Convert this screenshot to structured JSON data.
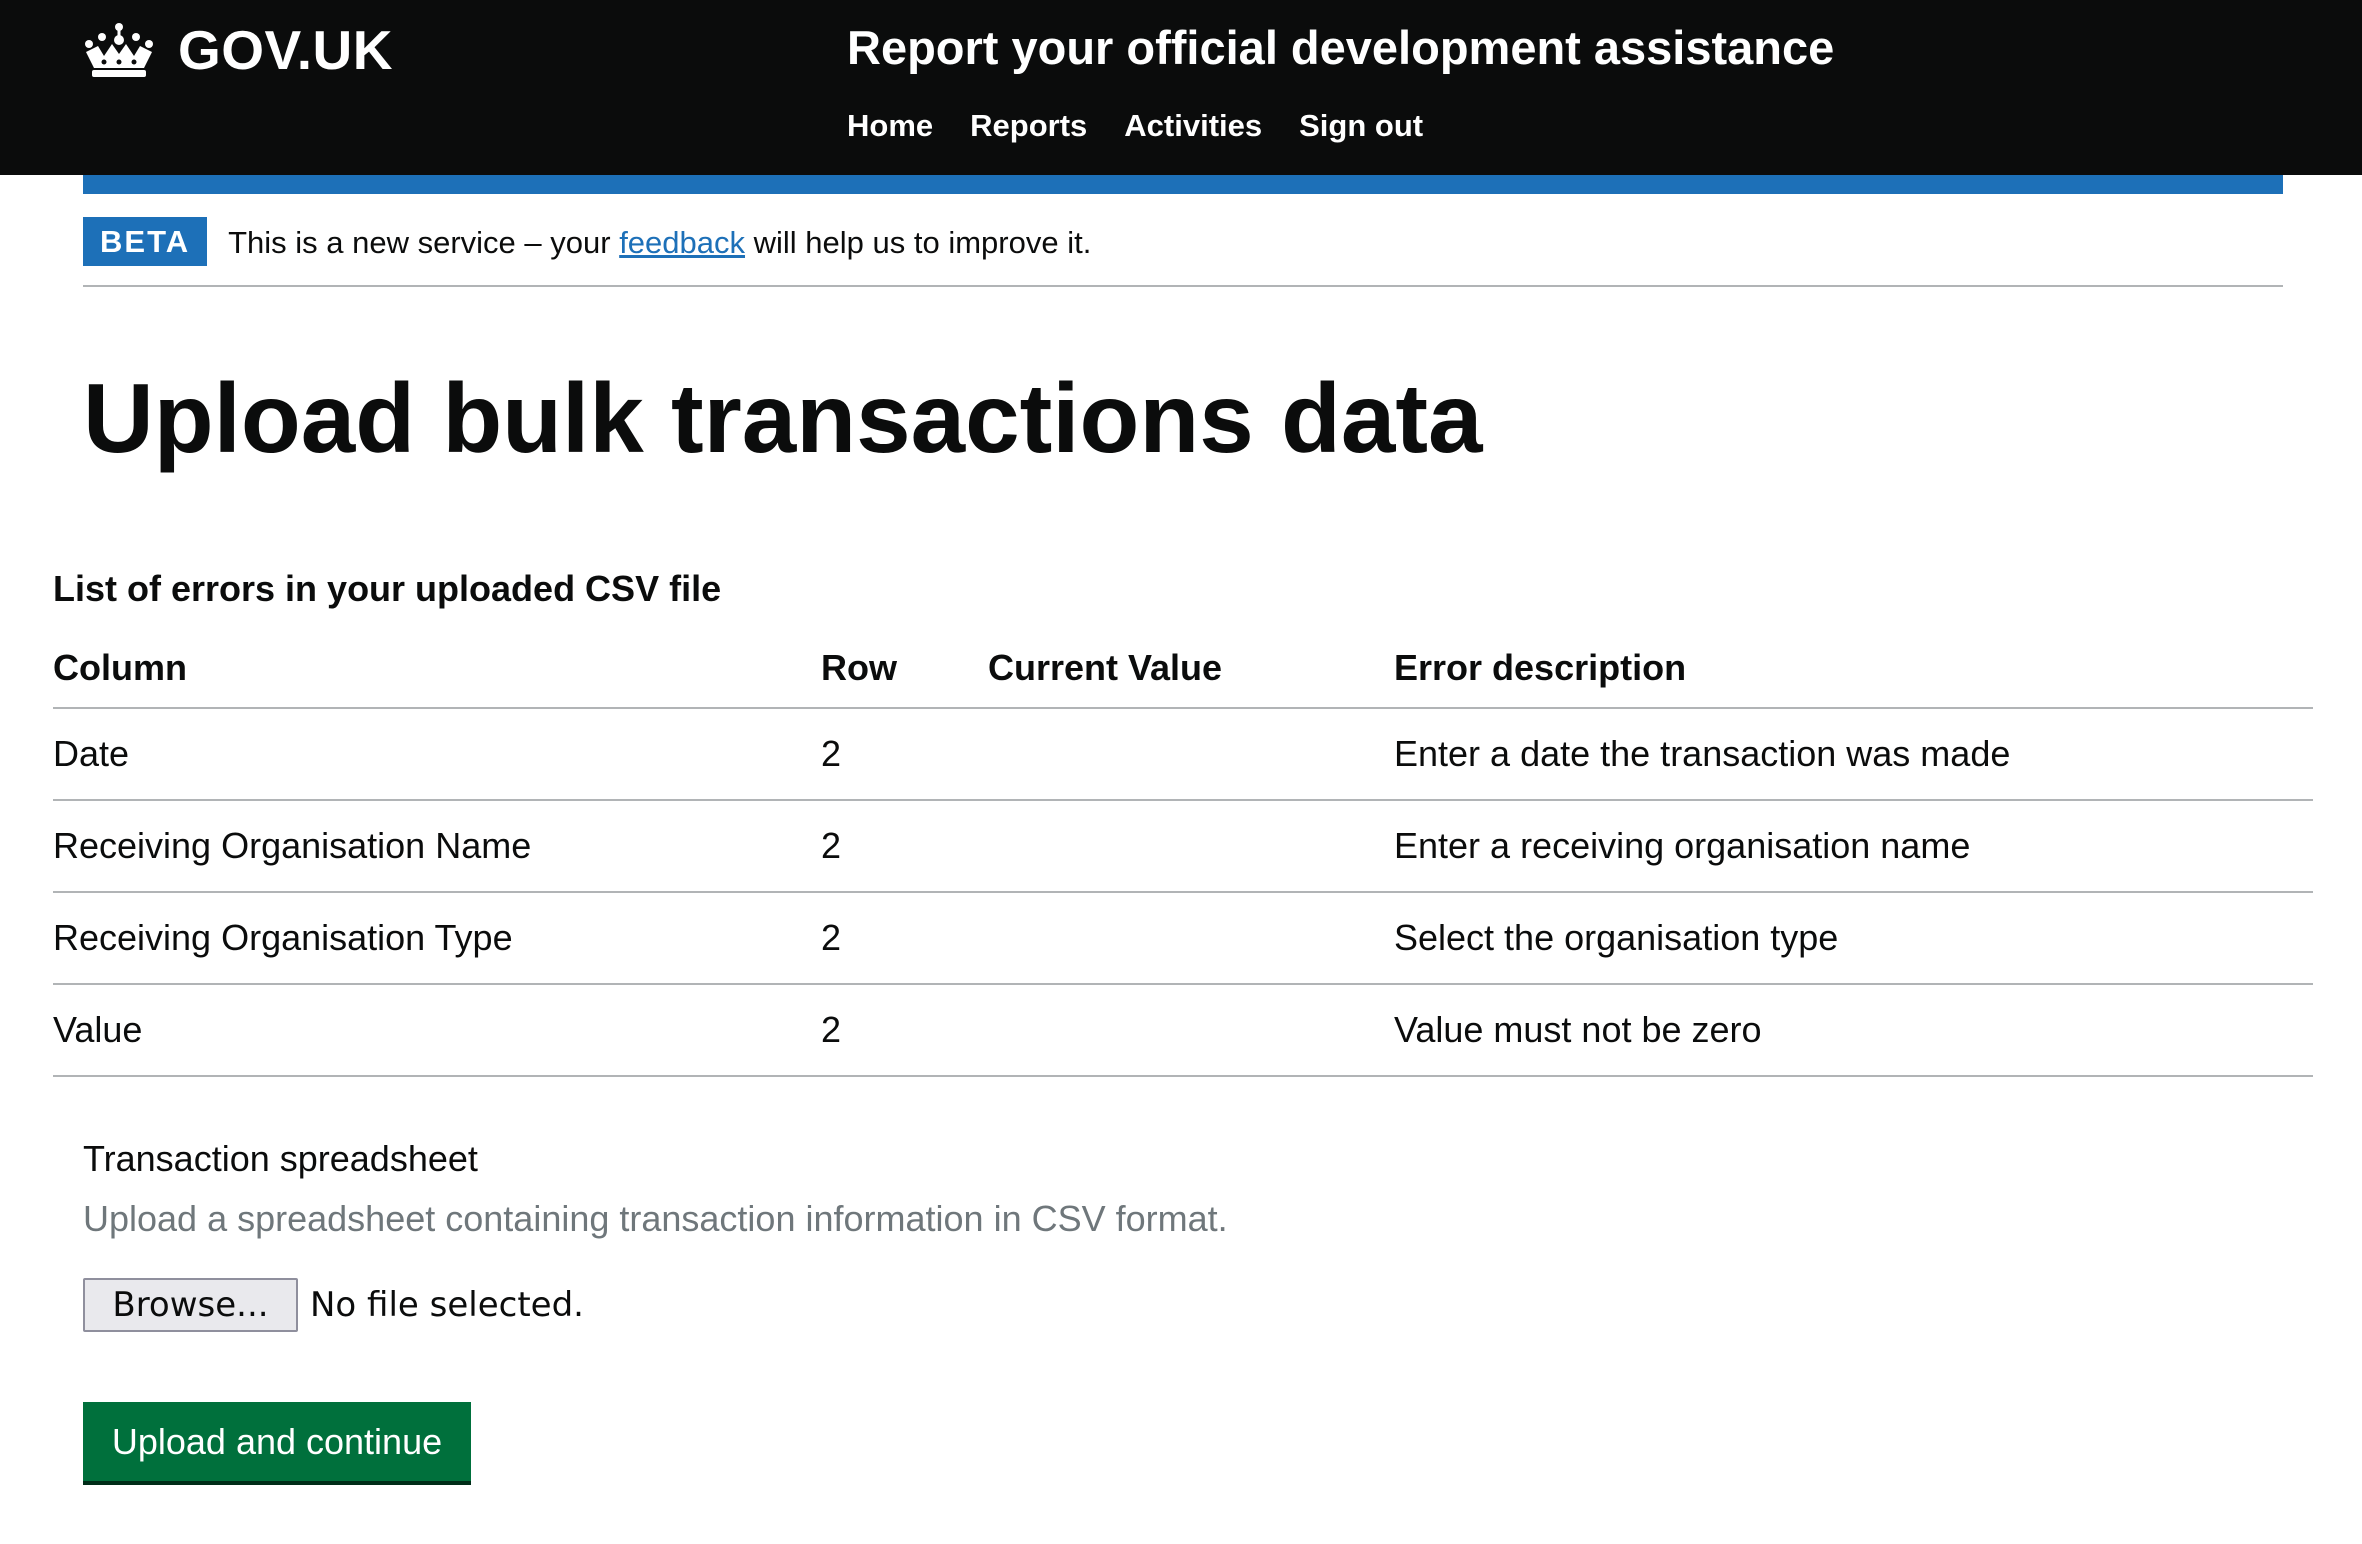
{
  "header": {
    "logo_text": "GOV.UK",
    "service_name": "Report your official development assistance",
    "nav": [
      {
        "label": "Home"
      },
      {
        "label": "Reports"
      },
      {
        "label": "Activities"
      },
      {
        "label": "Sign out"
      }
    ]
  },
  "phase_banner": {
    "tag": "BETA",
    "text_before": "This is a new service – your ",
    "link_text": "feedback",
    "text_after": " will help us to improve it."
  },
  "page": {
    "title": "Upload bulk transactions data"
  },
  "errors_table": {
    "caption": "List of errors in your uploaded CSV file",
    "headers": {
      "column": "Column",
      "row": "Row",
      "current_value": "Current Value",
      "error_description": "Error description"
    },
    "rows": [
      {
        "column": "Date",
        "row": "2",
        "current_value": "",
        "error_description": "Enter a date the transaction was made"
      },
      {
        "column": "Receiving Organisation Name",
        "row": "2",
        "current_value": "",
        "error_description": "Enter a receiving organisation name"
      },
      {
        "column": "Receiving Organisation Type",
        "row": "2",
        "current_value": "",
        "error_description": "Select the organisation type"
      },
      {
        "column": "Value",
        "row": "2",
        "current_value": "",
        "error_description": "Value must not be zero"
      }
    ]
  },
  "upload_form": {
    "label": "Transaction spreadsheet",
    "hint": "Upload a spreadsheet containing transaction information in CSV format.",
    "browse_label": "Browse...",
    "file_status": "No file selected.",
    "submit_label": "Upload and continue"
  },
  "colors": {
    "header_bg": "#0b0c0c",
    "brand_blue": "#1d70b8",
    "button_green": "#00703c",
    "hint_grey": "#6f777b",
    "border_grey": "#b1b4b6"
  },
  "icons": {
    "logo": "crown-icon"
  }
}
